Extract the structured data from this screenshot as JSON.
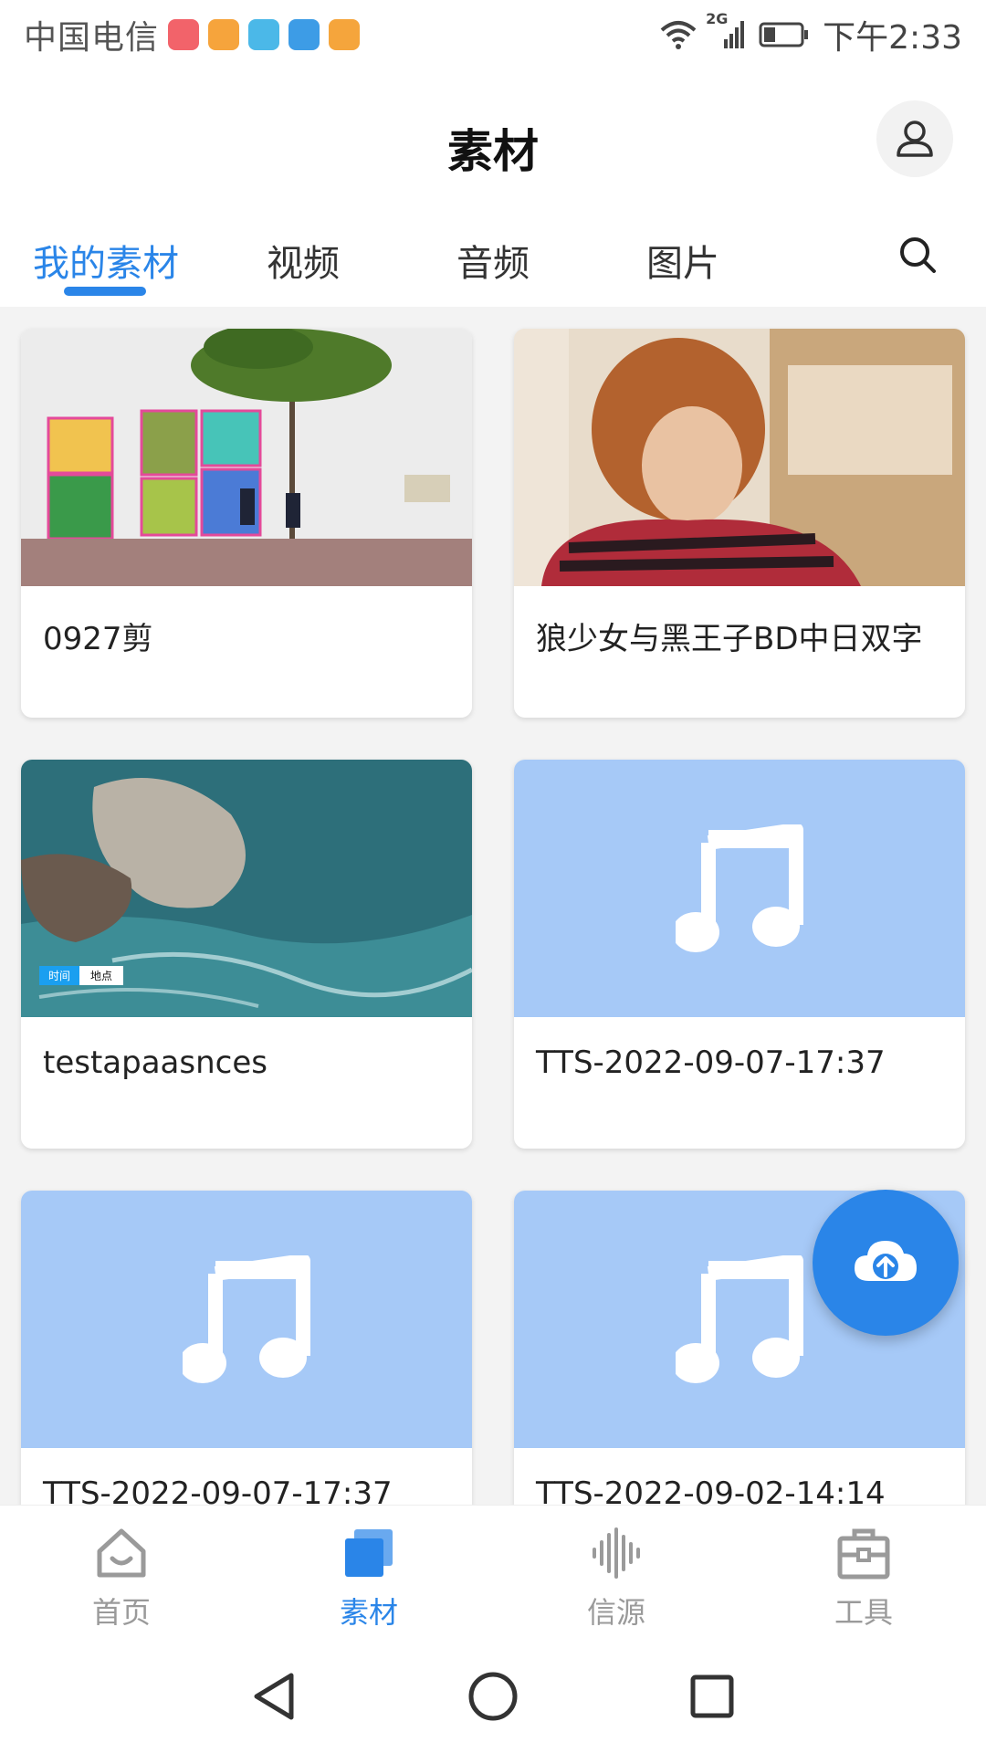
{
  "status_bar": {
    "carrier": "中国电信",
    "network": "2G",
    "time": "下午2:33"
  },
  "header": {
    "title": "素材"
  },
  "tabs": [
    {
      "label": "我的素材",
      "active": true
    },
    {
      "label": "视频",
      "active": false
    },
    {
      "label": "音频",
      "active": false
    },
    {
      "label": "图片",
      "active": false
    }
  ],
  "materials": [
    {
      "title": "0927剪",
      "type": "video",
      "thumb": "street-scene"
    },
    {
      "title": "狼少女与黑王子BD中日双字",
      "type": "video",
      "thumb": "boy-portrait"
    },
    {
      "title": "testapaasnces",
      "type": "video",
      "thumb": "sea-rocks",
      "overlay_labels": [
        "时间",
        "地点"
      ]
    },
    {
      "title": "TTS-2022-09-07-17:37",
      "type": "audio",
      "thumb": "music-note-icon"
    },
    {
      "title": "TTS-2022-09-07-17:37",
      "type": "audio",
      "thumb": "music-note-icon"
    },
    {
      "title": "TTS-2022-09-02-14:14",
      "type": "audio",
      "thumb": "music-note-icon"
    }
  ],
  "fab": {
    "icon": "cloud-upload-icon"
  },
  "bottom_nav": [
    {
      "label": "首页",
      "icon": "home-icon",
      "active": false
    },
    {
      "label": "素材",
      "icon": "files-icon",
      "active": true
    },
    {
      "label": "信源",
      "icon": "waveform-icon",
      "active": false
    },
    {
      "label": "工具",
      "icon": "toolbox-icon",
      "active": false
    }
  ],
  "colors": {
    "accent": "#2a85e8",
    "audio_thumb": "#a6c9f7",
    "inactive_nav": "#9a9a9a"
  }
}
